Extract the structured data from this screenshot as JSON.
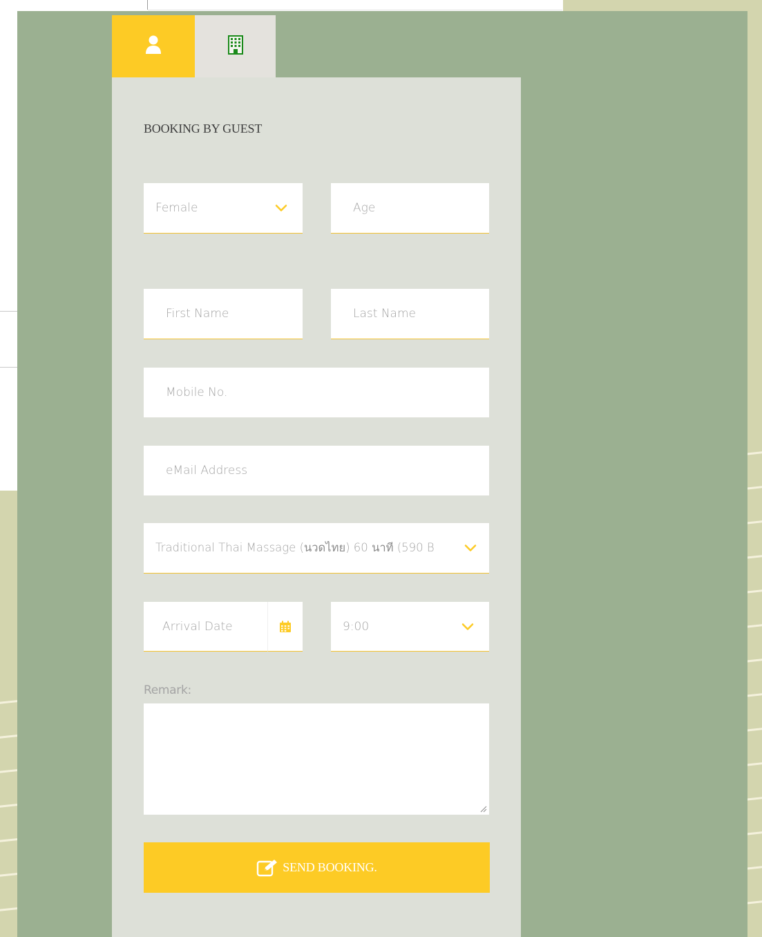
{
  "tabs": [
    {
      "icon": "user-icon",
      "active": true,
      "color": "#fdcb25"
    },
    {
      "icon": "building-icon",
      "active": false,
      "color": "#e4e2dd"
    }
  ],
  "form": {
    "title": "BOOKING BY GUEST",
    "gender": {
      "selected": "Female"
    },
    "age": {
      "placeholder": "Age"
    },
    "first_name": {
      "placeholder": "First Name"
    },
    "last_name": {
      "placeholder": "Last Name"
    },
    "mobile": {
      "placeholder": "Mobile No."
    },
    "email": {
      "placeholder": "eMail Address"
    },
    "service": {
      "selected_prefix": "Traditional Thai Massage (",
      "selected_thai_1": "นวดไทย",
      "selected_mid": ") 60 ",
      "selected_thai_2": "นาที",
      "selected_suffix": " (590 B"
    },
    "arrival_date": {
      "placeholder": "Arrival Date"
    },
    "time": {
      "selected": "9:00"
    },
    "remark_label": "Remark:",
    "remark_value": "",
    "send_label": "SEND BOOKING."
  },
  "colors": {
    "accent": "#fdcb25",
    "panel_green": "#9bb091",
    "card_bg": "#dde0d8",
    "background_beige": "#d3d5ae",
    "placeholder_text": "#a4a4a4"
  }
}
